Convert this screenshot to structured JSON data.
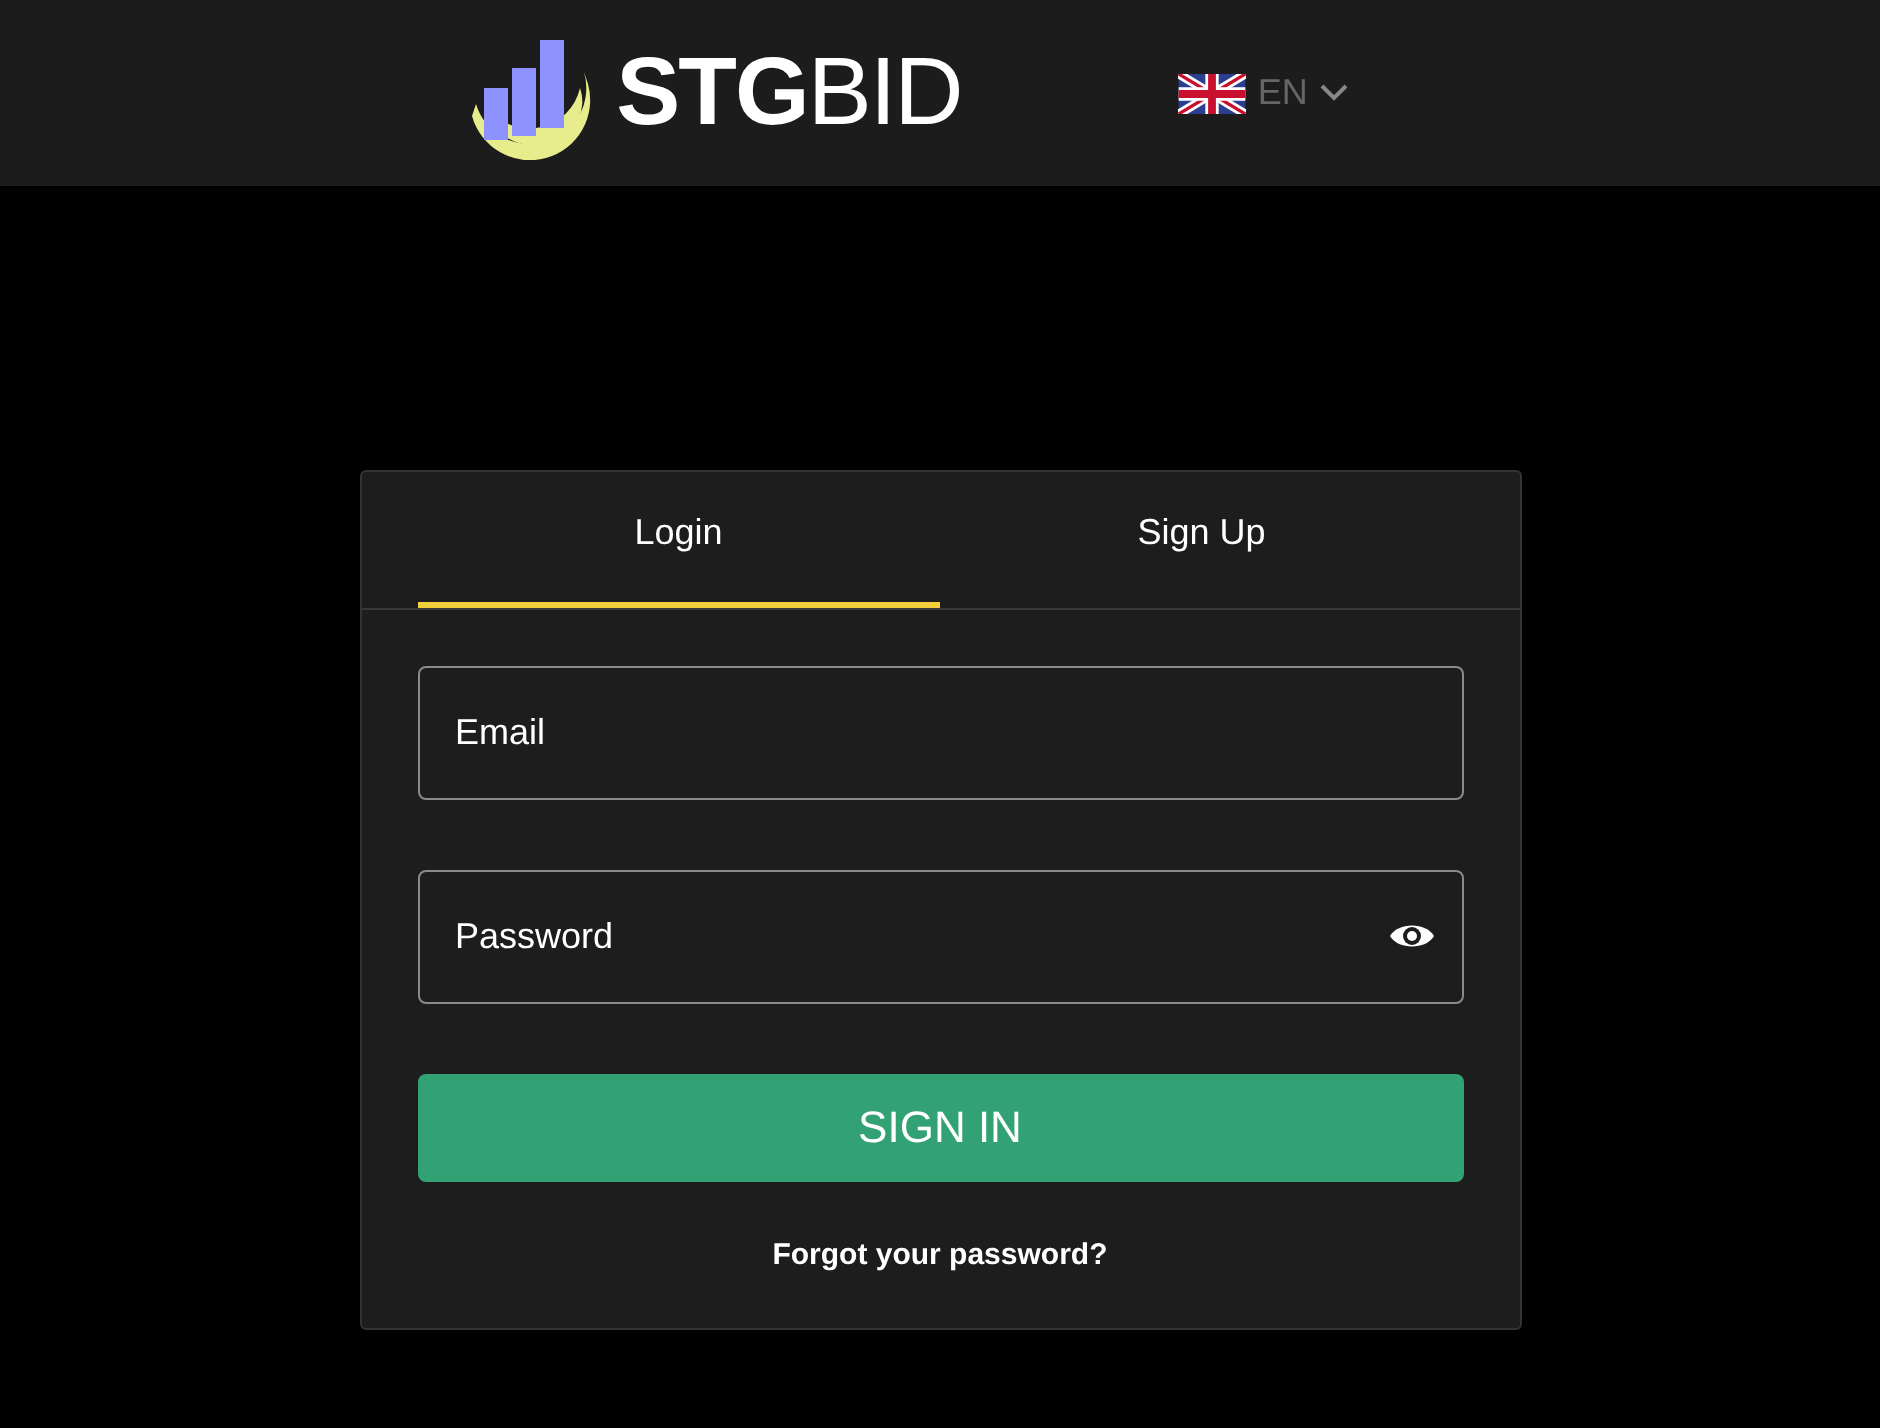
{
  "header": {
    "logo_text": "**STG**BID",
    "language": {
      "code": "EN"
    }
  },
  "tabs": [
    {
      "label": "Login",
      "selected": true
    },
    {
      "label": "Sign Up",
      "selected": false
    }
  ],
  "form": {
    "email": {
      "placeholder": "Email"
    },
    "password": {
      "placeholder": "Password"
    },
    "submit": "SIGN IN",
    "forgot_link": "Forgot your password?"
  }
}
